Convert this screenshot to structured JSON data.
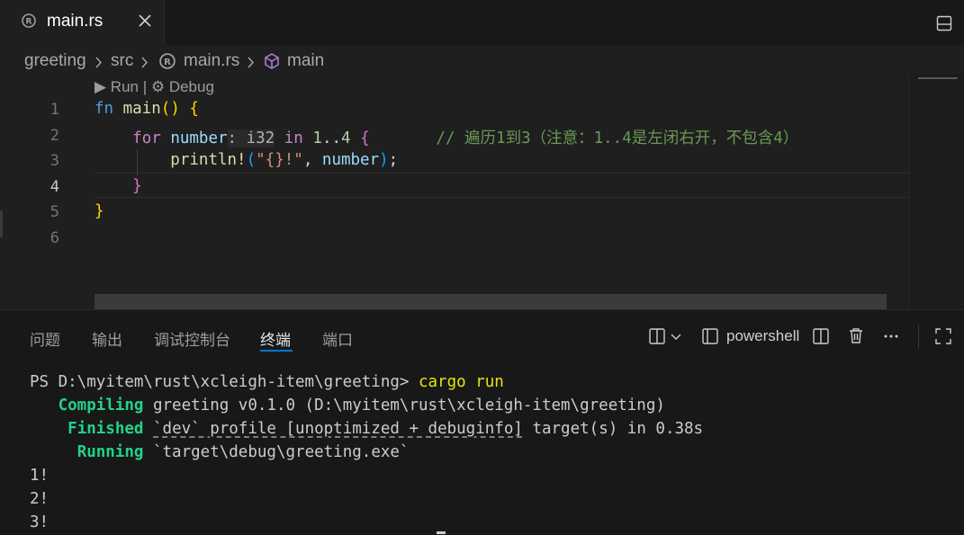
{
  "tab": {
    "title": "main.rs",
    "icon": "rust-file-icon"
  },
  "breadcrumb": {
    "folder": "greeting",
    "dir": "src",
    "file": "main.rs",
    "symbol": "main"
  },
  "codelens": {
    "run": "▶ Run",
    "separator": " | ",
    "debug": "⚙ Debug"
  },
  "editor": {
    "line_numbers": [
      "1",
      "2",
      "3",
      "4",
      "5",
      "6"
    ],
    "active_line": "4",
    "line1": {
      "kw": "fn",
      "name": "main",
      "parens": "()",
      "brace": "{"
    },
    "line2": {
      "kw": "for",
      "var": "number",
      "hint": ": i32",
      "in": "in",
      "range_start": "1",
      "range_op": "..",
      "range_end": "4",
      "brace": "{",
      "comment": "// 遍历1到3（注意：1..4是左闭右开，不包含4）"
    },
    "line3": {
      "macro": "println!",
      "open": "(",
      "str": "\"{}!\"",
      "comma": ", ",
      "arg": "number",
      "close": ")",
      "semi": ";"
    },
    "line4": {
      "brace": "}"
    },
    "line5": {
      "brace": "}"
    }
  },
  "panel": {
    "tabs": [
      "问题",
      "输出",
      "调试控制台",
      "终端",
      "端口"
    ],
    "active_tab": "终端",
    "terminal_name": "powershell"
  },
  "terminal": {
    "prompt": "PS D:\\myitem\\rust\\xcleigh-item\\greeting> ",
    "command": "cargo run",
    "compiling_label": "Compiling",
    "compiling_text": " greeting v0.1.0 (D:\\myitem\\rust\\xcleigh-item\\greeting)",
    "finished_label": "Finished",
    "finished_profile": "`dev` profile [unoptimized + debuginfo]",
    "finished_text": " target(s) in 0.38s",
    "running_label": "Running",
    "running_text": " `target\\debug\\greeting.exe`",
    "output": [
      "1!",
      "2!",
      "3!"
    ]
  },
  "colors": {
    "accent": "#0078d4",
    "terminal_green": "#23d18b",
    "terminal_yellow": "#e5e510"
  }
}
